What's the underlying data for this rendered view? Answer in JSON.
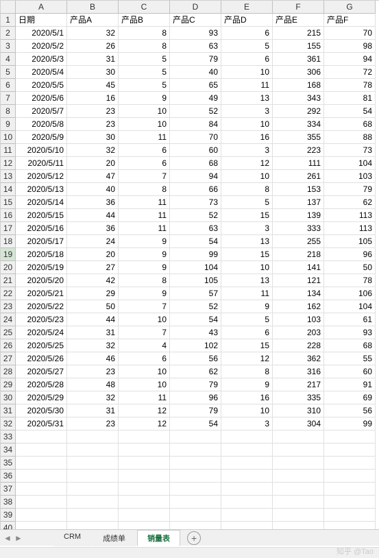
{
  "col_letters": [
    "A",
    "B",
    "C",
    "D",
    "E",
    "F",
    "G"
  ],
  "headers": [
    "日期",
    "产品A",
    "产品B",
    "产品C",
    "产品D",
    "产品E",
    "产品F"
  ],
  "selected_row": 19,
  "chart_data": {
    "type": "table",
    "title": "销量表",
    "categories": [
      "2020/5/1",
      "2020/5/2",
      "2020/5/3",
      "2020/5/4",
      "2020/5/5",
      "2020/5/6",
      "2020/5/7",
      "2020/5/8",
      "2020/5/9",
      "2020/5/10",
      "2020/5/11",
      "2020/5/12",
      "2020/5/13",
      "2020/5/14",
      "2020/5/15",
      "2020/5/16",
      "2020/5/17",
      "2020/5/18",
      "2020/5/19",
      "2020/5/20",
      "2020/5/21",
      "2020/5/22",
      "2020/5/23",
      "2020/5/24",
      "2020/5/25",
      "2020/5/26",
      "2020/5/27",
      "2020/5/28",
      "2020/5/29",
      "2020/5/30",
      "2020/5/31"
    ],
    "series": [
      {
        "name": "产品A",
        "values": [
          32,
          26,
          31,
          30,
          45,
          16,
          23,
          23,
          30,
          32,
          20,
          47,
          40,
          36,
          44,
          36,
          24,
          20,
          27,
          42,
          29,
          50,
          44,
          31,
          32,
          46,
          23,
          48,
          32,
          31,
          23
        ]
      },
      {
        "name": "产品B",
        "values": [
          8,
          8,
          5,
          5,
          5,
          9,
          10,
          10,
          11,
          6,
          6,
          7,
          8,
          11,
          11,
          11,
          9,
          9,
          9,
          8,
          9,
          7,
          10,
          7,
          4,
          6,
          10,
          10,
          11,
          12,
          12
        ]
      },
      {
        "name": "产品C",
        "values": [
          93,
          63,
          79,
          40,
          65,
          49,
          52,
          84,
          70,
          60,
          68,
          94,
          66,
          73,
          52,
          63,
          54,
          99,
          104,
          105,
          57,
          52,
          54,
          43,
          102,
          56,
          62,
          79,
          96,
          79,
          54
        ]
      },
      {
        "name": "产品D",
        "values": [
          6,
          5,
          6,
          10,
          11,
          13,
          3,
          10,
          16,
          3,
          12,
          10,
          8,
          5,
          15,
          3,
          13,
          15,
          10,
          13,
          11,
          9,
          5,
          6,
          15,
          12,
          8,
          9,
          16,
          10,
          3
        ]
      },
      {
        "name": "产品E",
        "values": [
          215,
          155,
          361,
          306,
          168,
          343,
          292,
          334,
          355,
          223,
          111,
          261,
          153,
          137,
          139,
          333,
          255,
          218,
          141,
          121,
          134,
          162,
          103,
          203,
          228,
          362,
          316,
          217,
          335,
          310,
          304
        ]
      },
      {
        "name": "产品F",
        "values": [
          70,
          98,
          94,
          72,
          78,
          81,
          54,
          68,
          88,
          73,
          104,
          103,
          79,
          62,
          113,
          113,
          105,
          96,
          50,
          78,
          106,
          104,
          61,
          93,
          68,
          55,
          60,
          91,
          69,
          56,
          99
        ]
      }
    ]
  },
  "rows": [
    [
      "2020/5/1",
      32,
      8,
      93,
      6,
      215,
      70
    ],
    [
      "2020/5/2",
      26,
      8,
      63,
      5,
      155,
      98
    ],
    [
      "2020/5/3",
      31,
      5,
      79,
      6,
      361,
      94
    ],
    [
      "2020/5/4",
      30,
      5,
      40,
      10,
      306,
      72
    ],
    [
      "2020/5/5",
      45,
      5,
      65,
      11,
      168,
      78
    ],
    [
      "2020/5/6",
      16,
      9,
      49,
      13,
      343,
      81
    ],
    [
      "2020/5/7",
      23,
      10,
      52,
      3,
      292,
      54
    ],
    [
      "2020/5/8",
      23,
      10,
      84,
      10,
      334,
      68
    ],
    [
      "2020/5/9",
      30,
      11,
      70,
      16,
      355,
      88
    ],
    [
      "2020/5/10",
      32,
      6,
      60,
      3,
      223,
      73
    ],
    [
      "2020/5/11",
      20,
      6,
      68,
      12,
      111,
      104
    ],
    [
      "2020/5/12",
      47,
      7,
      94,
      10,
      261,
      103
    ],
    [
      "2020/5/13",
      40,
      8,
      66,
      8,
      153,
      79
    ],
    [
      "2020/5/14",
      36,
      11,
      73,
      5,
      137,
      62
    ],
    [
      "2020/5/15",
      44,
      11,
      52,
      15,
      139,
      113
    ],
    [
      "2020/5/16",
      36,
      11,
      63,
      3,
      333,
      113
    ],
    [
      "2020/5/17",
      24,
      9,
      54,
      13,
      255,
      105
    ],
    [
      "2020/5/18",
      20,
      9,
      99,
      15,
      218,
      96
    ],
    [
      "2020/5/19",
      27,
      9,
      104,
      10,
      141,
      50
    ],
    [
      "2020/5/20",
      42,
      8,
      105,
      13,
      121,
      78
    ],
    [
      "2020/5/21",
      29,
      9,
      57,
      11,
      134,
      106
    ],
    [
      "2020/5/22",
      50,
      7,
      52,
      9,
      162,
      104
    ],
    [
      "2020/5/23",
      44,
      10,
      54,
      5,
      103,
      61
    ],
    [
      "2020/5/24",
      31,
      7,
      43,
      6,
      203,
      93
    ],
    [
      "2020/5/25",
      32,
      4,
      102,
      15,
      228,
      68
    ],
    [
      "2020/5/26",
      46,
      6,
      56,
      12,
      362,
      55
    ],
    [
      "2020/5/27",
      23,
      10,
      62,
      8,
      316,
      60
    ],
    [
      "2020/5/28",
      48,
      10,
      79,
      9,
      217,
      91
    ],
    [
      "2020/5/29",
      32,
      11,
      96,
      16,
      335,
      69
    ],
    [
      "2020/5/30",
      31,
      12,
      79,
      10,
      310,
      56
    ],
    [
      "2020/5/31",
      23,
      12,
      54,
      3,
      304,
      99
    ]
  ],
  "empty_rows": [
    33,
    34,
    35,
    36,
    37,
    38,
    39,
    40
  ],
  "tabs": {
    "items": [
      {
        "label": "CRM",
        "active": false
      },
      {
        "label": "成绩单",
        "active": false
      },
      {
        "label": "销量表",
        "active": true
      }
    ],
    "add_label": "+"
  },
  "nav": {
    "prev": "◄",
    "next": "►"
  },
  "watermark": "知乎 @Tao"
}
